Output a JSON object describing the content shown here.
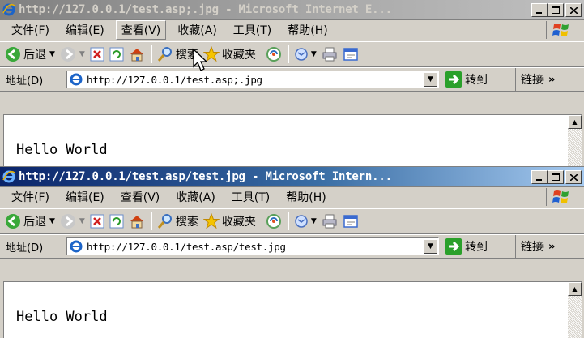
{
  "windows": [
    {
      "title": "http://127.0.0.1/test.asp;.jpg - Microsoft Internet E...",
      "active": false,
      "menu": [
        "文件(F)",
        "编辑(E)",
        "查看(V)",
        "收藏(A)",
        "工具(T)",
        "帮助(H)"
      ],
      "hovered_menu": "查看(V)",
      "toolbar": {
        "back": "后退",
        "search": "搜索",
        "favorites": "收藏夹"
      },
      "address_label": "地址(D)",
      "address_url": "http://127.0.0.1/test.asp;.jpg",
      "go_label": "转到",
      "links_label": "链接",
      "links_more": "»",
      "page_text": "Hello World"
    },
    {
      "title": "http://127.0.0.1/test.asp/test.jpg - Microsoft Intern...",
      "active": true,
      "menu": [
        "文件(F)",
        "编辑(E)",
        "查看(V)",
        "收藏(A)",
        "工具(T)",
        "帮助(H)"
      ],
      "toolbar": {
        "back": "后退",
        "search": "搜索",
        "favorites": "收藏夹"
      },
      "address_label": "地址(D)",
      "address_url": "http://127.0.0.1/test.asp/test.jpg",
      "go_label": "转到",
      "links_label": "链接",
      "links_more": "»",
      "page_text": "Hello World"
    }
  ],
  "colors": {
    "active_title_start": "#0a246a",
    "active_title_end": "#a6caf0",
    "inactive_title_start": "#808080",
    "inactive_title_end": "#c0c0c0",
    "chrome": "#d4d0c8"
  },
  "icons": [
    "ie-logo-icon",
    "minimize-icon",
    "maximize-icon",
    "close-icon",
    "windows-flag-icon",
    "back-icon",
    "forward-icon",
    "stop-icon",
    "refresh-icon",
    "home-icon",
    "search-icon",
    "favorites-icon",
    "media-icon",
    "mail-icon",
    "print-icon",
    "edit-icon",
    "page-icon",
    "go-icon",
    "mouse-cursor-icon"
  ]
}
